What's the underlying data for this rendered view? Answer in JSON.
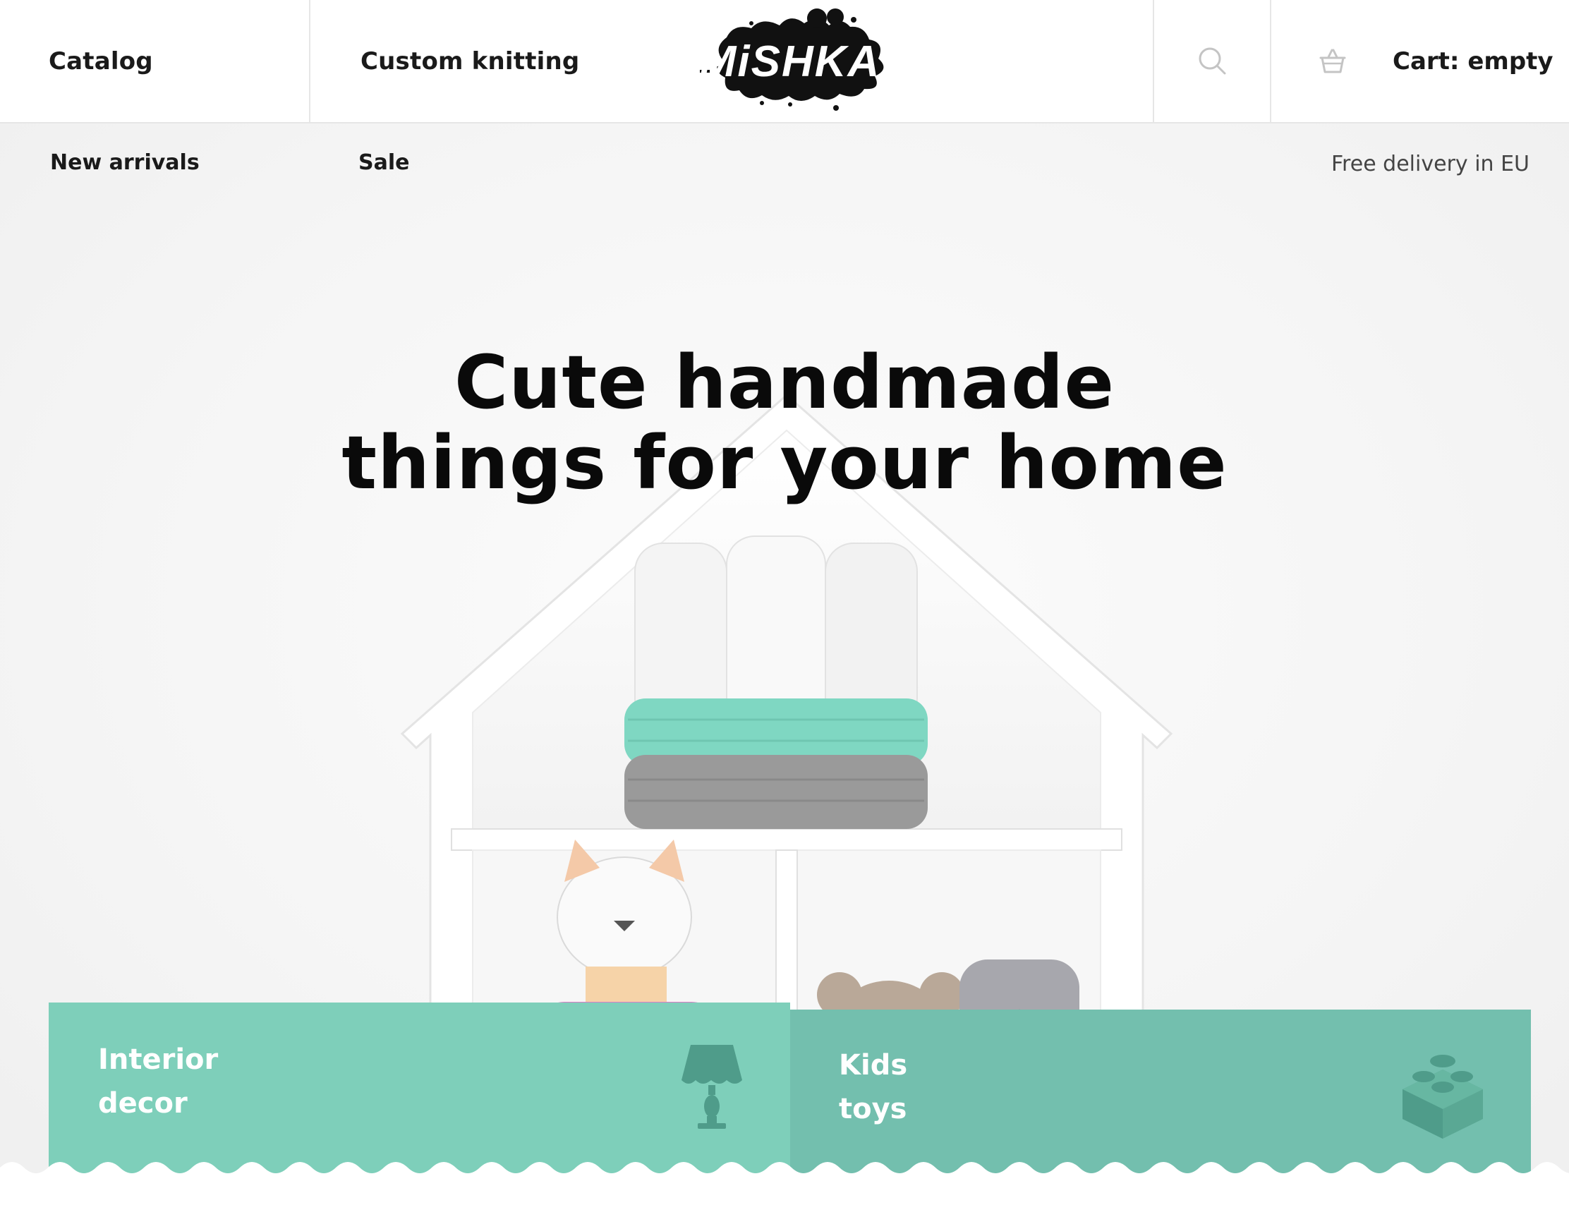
{
  "header": {
    "nav": [
      {
        "label": "Catalog"
      },
      {
        "label": "Custom knitting"
      }
    ],
    "logo_text": "MiSHKA",
    "search_icon": "search-icon",
    "cart_icon": "basket-icon",
    "cart_label": "Cart: empty"
  },
  "subnav": {
    "items": [
      {
        "label": "New arrivals"
      },
      {
        "label": "Sale"
      }
    ],
    "delivery": "Free delivery in EU"
  },
  "hero": {
    "title_line1": "Cute handmade",
    "title_line2": "things for your home"
  },
  "categories": [
    {
      "label_line1": "Interior",
      "label_line2": "decor",
      "icon": "lamp-icon",
      "color": "#7ecfba"
    },
    {
      "label_line1": "Kids",
      "label_line2": "toys",
      "icon": "toy-brick-icon",
      "color": "#73bfae"
    }
  ],
  "colors": {
    "accent": "#7ecfba",
    "accent_dark": "#73bfae",
    "text": "#1a1a1a"
  }
}
